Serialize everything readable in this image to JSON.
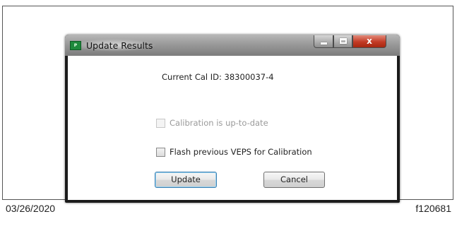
{
  "window": {
    "title": "Update Results",
    "icon": "app-icon",
    "controls": {
      "minimize": "minimize-icon",
      "maximize": "maximize-icon",
      "close": "close-icon",
      "close_glyph": "x"
    }
  },
  "dialog": {
    "cal_id_text": "Current Cal ID: 38300037-4",
    "calibration_checkbox": {
      "label": "Calibration is up-to-date",
      "checked": false,
      "enabled": false
    },
    "flash_checkbox": {
      "label": "Flash previous VEPS for Calibration",
      "checked": false,
      "enabled": true
    },
    "update_label": "Update",
    "cancel_label": "Cancel"
  },
  "footer": {
    "date": "03/26/2020",
    "ref": "f120681"
  },
  "colors": {
    "close_button": "#c23a24",
    "app_icon": "#1e8a3c"
  }
}
